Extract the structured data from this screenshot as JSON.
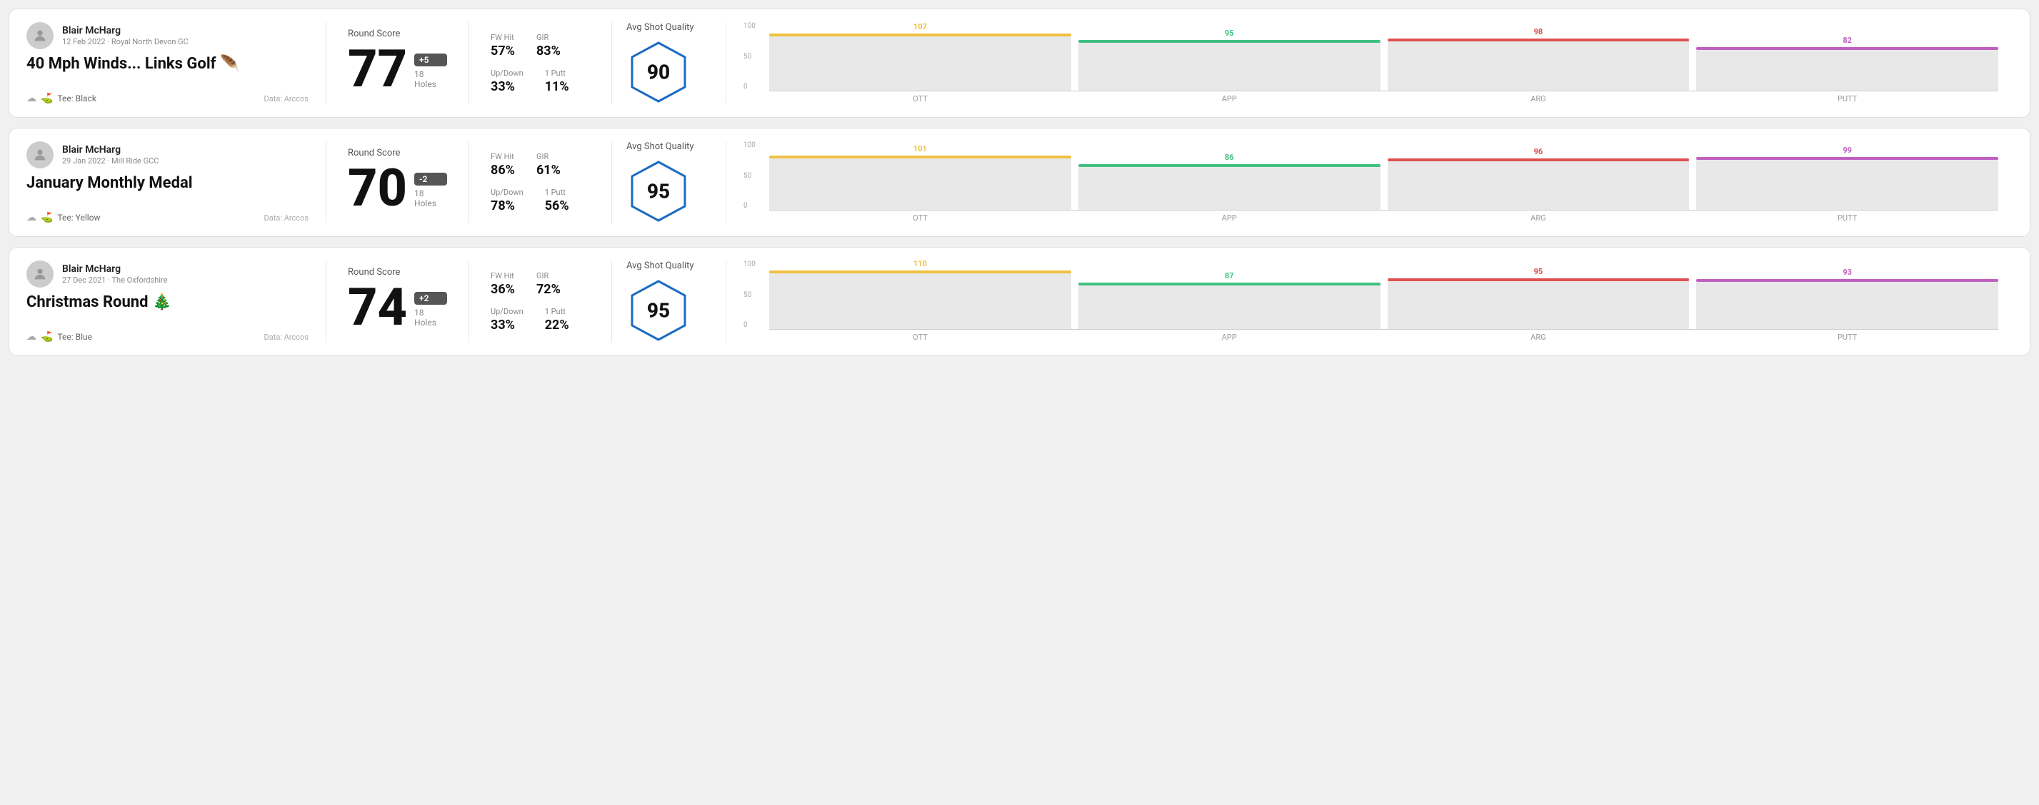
{
  "rounds": [
    {
      "id": "round1",
      "user": {
        "name": "Blair McHarg",
        "date": "12 Feb 2022 · Royal North Devon GC"
      },
      "title": "40 Mph Winds... Links Golf 🪶",
      "tee": "Black",
      "data_source": "Data: Arccos",
      "score": {
        "label": "Round Score",
        "number": "77",
        "badge": "+5",
        "holes": "18 Holes"
      },
      "stats": {
        "fw_hit_label": "FW Hit",
        "fw_hit_value": "57%",
        "gir_label": "GIR",
        "gir_value": "83%",
        "updown_label": "Up/Down",
        "updown_value": "33%",
        "oneputt_label": "1 Putt",
        "oneputt_value": "11%"
      },
      "quality": {
        "label": "Avg Shot Quality",
        "score": "90"
      },
      "chart": {
        "bars": [
          {
            "label": "OTT",
            "value": 107,
            "color": "#f0c040"
          },
          {
            "label": "APP",
            "value": 95,
            "color": "#40c080"
          },
          {
            "label": "ARG",
            "value": 98,
            "color": "#e05050"
          },
          {
            "label": "PUTT",
            "value": 82,
            "color": "#c060c0"
          }
        ],
        "y_labels": [
          "100",
          "50",
          "0"
        ]
      }
    },
    {
      "id": "round2",
      "user": {
        "name": "Blair McHarg",
        "date": "29 Jan 2022 · Mill Ride GCC"
      },
      "title": "January Monthly Medal",
      "tee": "Yellow",
      "data_source": "Data: Arccos",
      "score": {
        "label": "Round Score",
        "number": "70",
        "badge": "-2",
        "holes": "18 Holes"
      },
      "stats": {
        "fw_hit_label": "FW Hit",
        "fw_hit_value": "86%",
        "gir_label": "GIR",
        "gir_value": "61%",
        "updown_label": "Up/Down",
        "updown_value": "78%",
        "oneputt_label": "1 Putt",
        "oneputt_value": "56%"
      },
      "quality": {
        "label": "Avg Shot Quality",
        "score": "95"
      },
      "chart": {
        "bars": [
          {
            "label": "OTT",
            "value": 101,
            "color": "#f0c040"
          },
          {
            "label": "APP",
            "value": 86,
            "color": "#40c080"
          },
          {
            "label": "ARG",
            "value": 96,
            "color": "#e05050"
          },
          {
            "label": "PUTT",
            "value": 99,
            "color": "#c060c0"
          }
        ],
        "y_labels": [
          "100",
          "50",
          "0"
        ]
      }
    },
    {
      "id": "round3",
      "user": {
        "name": "Blair McHarg",
        "date": "27 Dec 2021 · The Oxfordshire"
      },
      "title": "Christmas Round 🎄",
      "tee": "Blue",
      "data_source": "Data: Arccos",
      "score": {
        "label": "Round Score",
        "number": "74",
        "badge": "+2",
        "holes": "18 Holes"
      },
      "stats": {
        "fw_hit_label": "FW Hit",
        "fw_hit_value": "36%",
        "gir_label": "GIR",
        "gir_value": "72%",
        "updown_label": "Up/Down",
        "updown_value": "33%",
        "oneputt_label": "1 Putt",
        "oneputt_value": "22%"
      },
      "quality": {
        "label": "Avg Shot Quality",
        "score": "95"
      },
      "chart": {
        "bars": [
          {
            "label": "OTT",
            "value": 110,
            "color": "#f0c040"
          },
          {
            "label": "APP",
            "value": 87,
            "color": "#40c080"
          },
          {
            "label": "ARG",
            "value": 95,
            "color": "#e05050"
          },
          {
            "label": "PUTT",
            "value": 93,
            "color": "#c060c0"
          }
        ],
        "y_labels": [
          "100",
          "50",
          "0"
        ]
      }
    }
  ]
}
